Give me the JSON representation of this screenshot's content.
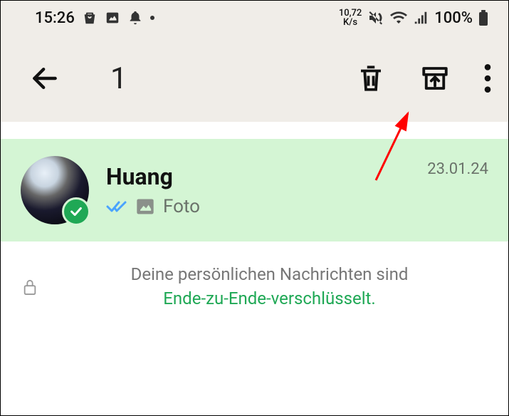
{
  "status_bar": {
    "time": "15:26",
    "speed_line1": "10,72",
    "speed_line2": "K/s",
    "battery_percent": "100%"
  },
  "toolbar": {
    "selected_count": "1"
  },
  "chat": {
    "name": "Huang",
    "date": "23.01.24",
    "preview_label": "Foto"
  },
  "encryption": {
    "text_before": "Deine persönlichen Nachrichten sind ",
    "link": "Ende-zu-Ende-verschlüsselt"
  }
}
